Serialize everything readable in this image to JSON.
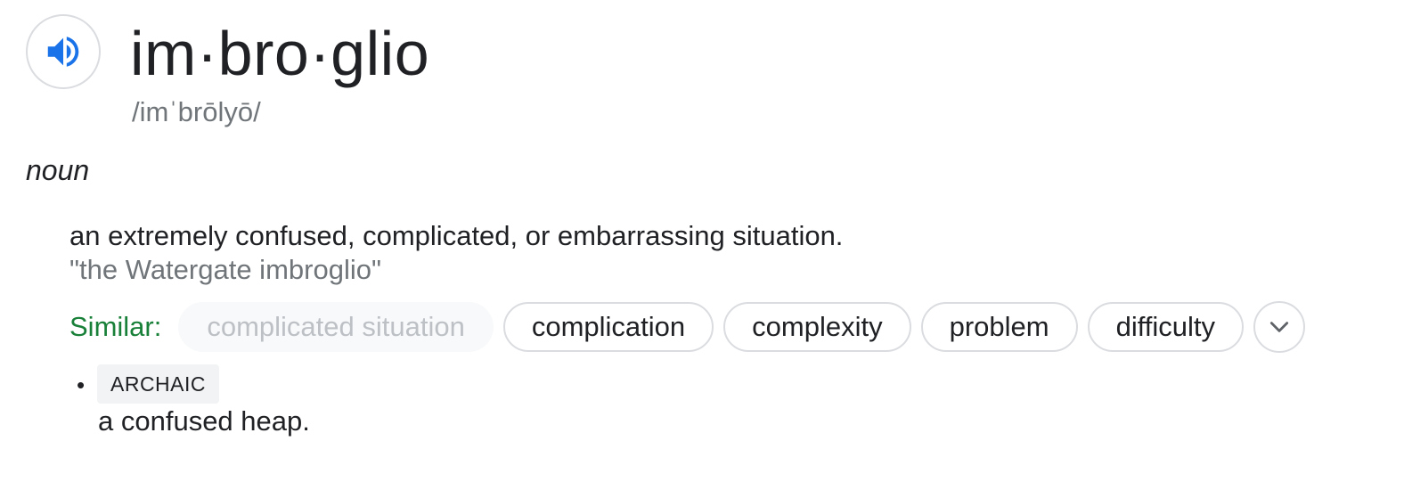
{
  "entry": {
    "headword": "im·bro·glio",
    "pronunciation": "/imˈbrōlyō/",
    "part_of_speech": "noun"
  },
  "audio": {
    "icon": "speaker-icon",
    "accent_color": "#1a73e8"
  },
  "senses": [
    {
      "definition": "an extremely confused, complicated, or embarrassing situation.",
      "example": "\"the Watergate imbroglio\"",
      "similar": {
        "label": "Similar:",
        "label_color": "#188038",
        "chips": [
          {
            "text": "complicated situation",
            "enabled": false
          },
          {
            "text": "complication",
            "enabled": true
          },
          {
            "text": "complexity",
            "enabled": true
          },
          {
            "text": "problem",
            "enabled": true
          },
          {
            "text": "difficulty",
            "enabled": true
          }
        ],
        "expand_icon": "chevron-down-icon"
      }
    },
    {
      "bullet": "•",
      "label": "ARCHAIC",
      "definition": "a confused heap."
    }
  ]
}
